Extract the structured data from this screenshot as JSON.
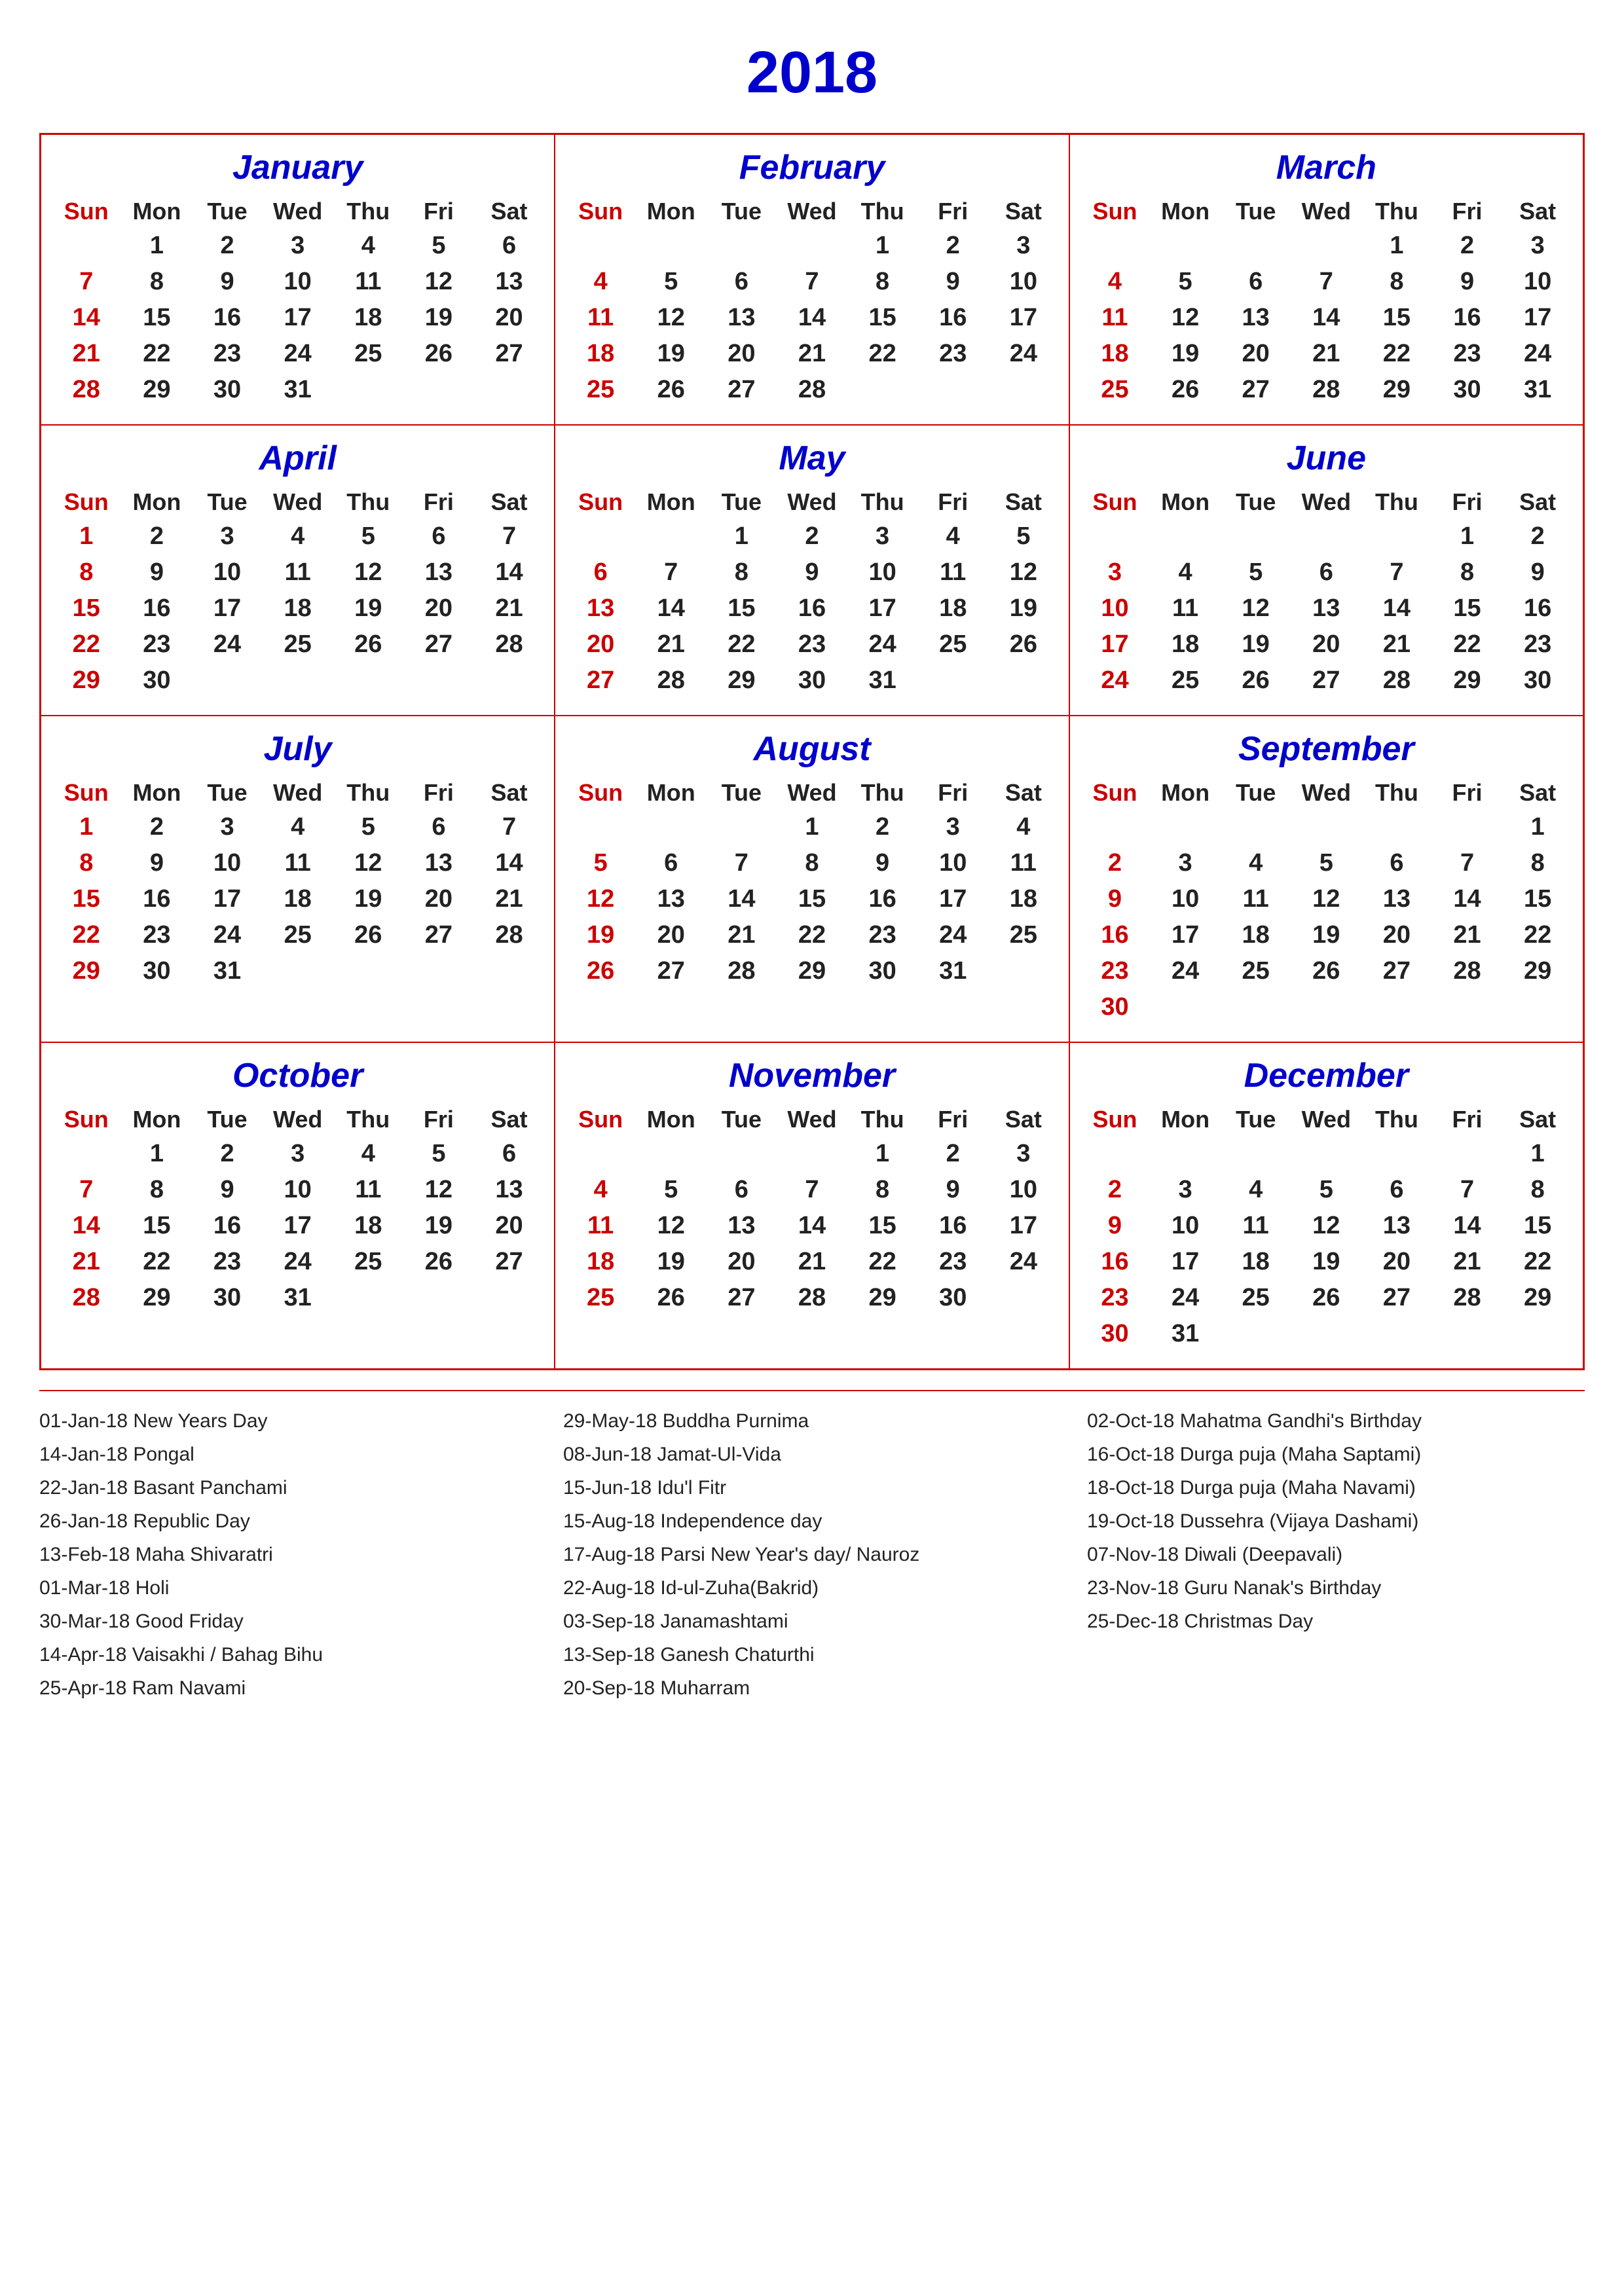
{
  "title": "2018",
  "months": [
    {
      "name": "January",
      "startDay": 1,
      "days": 31,
      "weeks": [
        [
          "",
          "1",
          "2",
          "3",
          "4",
          "5",
          "6"
        ],
        [
          "7",
          "8",
          "9",
          "10",
          "11",
          "12",
          "13"
        ],
        [
          "14",
          "15",
          "16",
          "17",
          "18",
          "19",
          "20"
        ],
        [
          "21",
          "22",
          "23",
          "24",
          "25",
          "26",
          "27"
        ],
        [
          "28",
          "29",
          "30",
          "31",
          "",
          "",
          ""
        ]
      ]
    },
    {
      "name": "February",
      "startDay": 4,
      "days": 28,
      "weeks": [
        [
          "",
          "",
          "",
          "",
          "1",
          "2",
          "3"
        ],
        [
          "4",
          "5",
          "6",
          "7",
          "8",
          "9",
          "10"
        ],
        [
          "11",
          "12",
          "13",
          "14",
          "15",
          "16",
          "17"
        ],
        [
          "18",
          "19",
          "20",
          "21",
          "22",
          "23",
          "24"
        ],
        [
          "25",
          "26",
          "27",
          "28",
          "",
          "",
          ""
        ]
      ]
    },
    {
      "name": "March",
      "startDay": 4,
      "days": 31,
      "weeks": [
        [
          "",
          "",
          "",
          "",
          "1",
          "2",
          "3"
        ],
        [
          "4",
          "5",
          "6",
          "7",
          "8",
          "9",
          "10"
        ],
        [
          "11",
          "12",
          "13",
          "14",
          "15",
          "16",
          "17"
        ],
        [
          "18",
          "19",
          "20",
          "21",
          "22",
          "23",
          "24"
        ],
        [
          "25",
          "26",
          "27",
          "28",
          "29",
          "30",
          "31"
        ]
      ]
    },
    {
      "name": "April",
      "startDay": 0,
      "days": 30,
      "weeks": [
        [
          "1",
          "2",
          "3",
          "4",
          "5",
          "6",
          "7"
        ],
        [
          "8",
          "9",
          "10",
          "11",
          "12",
          "13",
          "14"
        ],
        [
          "15",
          "16",
          "17",
          "18",
          "19",
          "20",
          "21"
        ],
        [
          "22",
          "23",
          "24",
          "25",
          "26",
          "27",
          "28"
        ],
        [
          "29",
          "30",
          "",
          "",
          "",
          "",
          ""
        ]
      ]
    },
    {
      "name": "May",
      "startDay": 2,
      "days": 31,
      "weeks": [
        [
          "",
          "",
          "1",
          "2",
          "3",
          "4",
          "5"
        ],
        [
          "6",
          "7",
          "8",
          "9",
          "10",
          "11",
          "12"
        ],
        [
          "13",
          "14",
          "15",
          "16",
          "17",
          "18",
          "19"
        ],
        [
          "20",
          "21",
          "22",
          "23",
          "24",
          "25",
          "26"
        ],
        [
          "27",
          "28",
          "29",
          "30",
          "31",
          "",
          ""
        ]
      ]
    },
    {
      "name": "June",
      "startDay": 5,
      "days": 30,
      "weeks": [
        [
          "",
          "",
          "",
          "",
          "",
          "1",
          "2"
        ],
        [
          "3",
          "4",
          "5",
          "6",
          "7",
          "8",
          "9"
        ],
        [
          "10",
          "11",
          "12",
          "13",
          "14",
          "15",
          "16"
        ],
        [
          "17",
          "18",
          "19",
          "20",
          "21",
          "22",
          "23"
        ],
        [
          "24",
          "25",
          "26",
          "27",
          "28",
          "29",
          "30"
        ]
      ]
    },
    {
      "name": "July",
      "startDay": 0,
      "days": 31,
      "weeks": [
        [
          "1",
          "2",
          "3",
          "4",
          "5",
          "6",
          "7"
        ],
        [
          "8",
          "9",
          "10",
          "11",
          "12",
          "13",
          "14"
        ],
        [
          "15",
          "16",
          "17",
          "18",
          "19",
          "20",
          "21"
        ],
        [
          "22",
          "23",
          "24",
          "25",
          "26",
          "27",
          "28"
        ],
        [
          "29",
          "30",
          "31",
          "",
          "",
          "",
          ""
        ]
      ]
    },
    {
      "name": "August",
      "startDay": 3,
      "days": 31,
      "weeks": [
        [
          "",
          "",
          "",
          "1",
          "2",
          "3",
          "4"
        ],
        [
          "5",
          "6",
          "7",
          "8",
          "9",
          "10",
          "11"
        ],
        [
          "12",
          "13",
          "14",
          "15",
          "16",
          "17",
          "18"
        ],
        [
          "19",
          "20",
          "21",
          "22",
          "23",
          "24",
          "25"
        ],
        [
          "26",
          "27",
          "28",
          "29",
          "30",
          "31",
          ""
        ]
      ]
    },
    {
      "name": "September",
      "startDay": 6,
      "days": 30,
      "weeks": [
        [
          "",
          "",
          "",
          "",
          "",
          "",
          "1"
        ],
        [
          "2",
          "3",
          "4",
          "5",
          "6",
          "7",
          "8"
        ],
        [
          "9",
          "10",
          "11",
          "12",
          "13",
          "14",
          "15"
        ],
        [
          "16",
          "17",
          "18",
          "19",
          "20",
          "21",
          "22"
        ],
        [
          "23",
          "24",
          "25",
          "26",
          "27",
          "28",
          "29"
        ],
        [
          "30",
          "",
          "",
          "",
          "",
          "",
          ""
        ]
      ]
    },
    {
      "name": "October",
      "startDay": 1,
      "days": 31,
      "weeks": [
        [
          "",
          "1",
          "2",
          "3",
          "4",
          "5",
          "6"
        ],
        [
          "7",
          "8",
          "9",
          "10",
          "11",
          "12",
          "13"
        ],
        [
          "14",
          "15",
          "16",
          "17",
          "18",
          "19",
          "20"
        ],
        [
          "21",
          "22",
          "23",
          "24",
          "25",
          "26",
          "27"
        ],
        [
          "28",
          "29",
          "30",
          "31",
          "",
          "",
          ""
        ]
      ]
    },
    {
      "name": "November",
      "startDay": 4,
      "days": 30,
      "weeks": [
        [
          "",
          "",
          "",
          "",
          "1",
          "2",
          "3"
        ],
        [
          "4",
          "5",
          "6",
          "7",
          "8",
          "9",
          "10"
        ],
        [
          "11",
          "12",
          "13",
          "14",
          "15",
          "16",
          "17"
        ],
        [
          "18",
          "19",
          "20",
          "21",
          "22",
          "23",
          "24"
        ],
        [
          "25",
          "26",
          "27",
          "28",
          "29",
          "30",
          ""
        ]
      ]
    },
    {
      "name": "December",
      "startDay": 6,
      "days": 31,
      "weeks": [
        [
          "",
          "",
          "",
          "",
          "",
          "",
          "1"
        ],
        [
          "2",
          "3",
          "4",
          "5",
          "6",
          "7",
          "8"
        ],
        [
          "9",
          "10",
          "11",
          "12",
          "13",
          "14",
          "15"
        ],
        [
          "16",
          "17",
          "18",
          "19",
          "20",
          "21",
          "22"
        ],
        [
          "23",
          "24",
          "25",
          "26",
          "27",
          "28",
          "29"
        ],
        [
          "30",
          "31",
          "",
          "",
          "",
          "",
          ""
        ]
      ]
    }
  ],
  "dayHeaders": [
    "Sun",
    "Mon",
    "Tue",
    "Wed",
    "Thu",
    "Fri",
    "Sat"
  ],
  "holidays": {
    "col1": [
      "01-Jan-18 New Years Day",
      "14-Jan-18 Pongal",
      "22-Jan-18 Basant Panchami",
      "26-Jan-18 Republic Day",
      "13-Feb-18 Maha Shivaratri",
      "01-Mar-18 Holi",
      "30-Mar-18 Good Friday",
      "14-Apr-18 Vaisakhi / Bahag Bihu",
      "25-Apr-18 Ram Navami"
    ],
    "col2": [
      "29-May-18 Buddha Purnima",
      "08-Jun-18 Jamat-Ul-Vida",
      "15-Jun-18 Idu'l Fitr",
      "15-Aug-18 Independence day",
      "17-Aug-18 Parsi New Year's day/ Nauroz",
      "22-Aug-18 Id-ul-Zuha(Bakrid)",
      "03-Sep-18 Janamashtami",
      "13-Sep-18 Ganesh Chaturthi",
      "20-Sep-18 Muharram"
    ],
    "col3": [
      "02-Oct-18 Mahatma Gandhi's Birthday",
      "16-Oct-18 Durga puja (Maha Saptami)",
      "18-Oct-18 Durga puja (Maha Navami)",
      "19-Oct-18 Dussehra (Vijaya Dashami)",
      "07-Nov-18 Diwali (Deepavali)",
      "23-Nov-18 Guru Nanak's Birthday",
      "25-Dec-18 Christmas Day"
    ]
  }
}
